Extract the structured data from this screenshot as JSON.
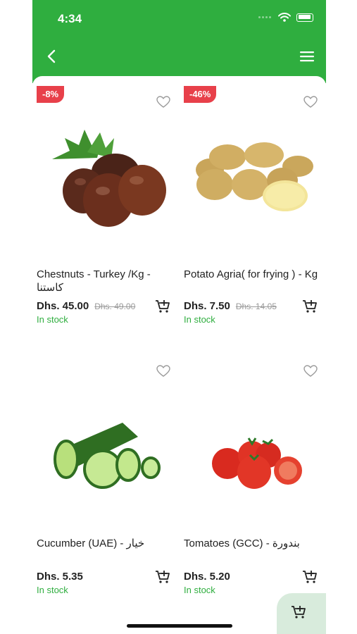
{
  "status_bar": {
    "time": "4:34"
  },
  "header": {
    "back_icon": "chevron-left-icon",
    "menu_icon": "hamburger-menu-icon",
    "color": "#2fae3f"
  },
  "products": [
    {
      "name": "Chestnuts - Turkey /Kg - كاستنا",
      "price": "Dhs. 45.00",
      "old_price": "Dhs. 49.00",
      "discount": "-8%",
      "stock": "In stock"
    },
    {
      "name": "Potato Agria( for frying ) - Kg",
      "price": "Dhs. 7.50",
      "old_price": "Dhs. 14.05",
      "discount": "-46%",
      "stock": "In stock"
    },
    {
      "name": "Cucumber (UAE) - خيار",
      "price": "Dhs. 5.35",
      "old_price": "",
      "discount": "",
      "stock": "In stock"
    },
    {
      "name": "Tomatoes (GCC) - بندورة",
      "price": "Dhs. 5.20",
      "old_price": "",
      "discount": "",
      "stock": "In stock"
    }
  ],
  "colors": {
    "accent": "#2fae3f",
    "discount_badge": "#e8404a",
    "fab_bg": "#d8ebdc"
  }
}
